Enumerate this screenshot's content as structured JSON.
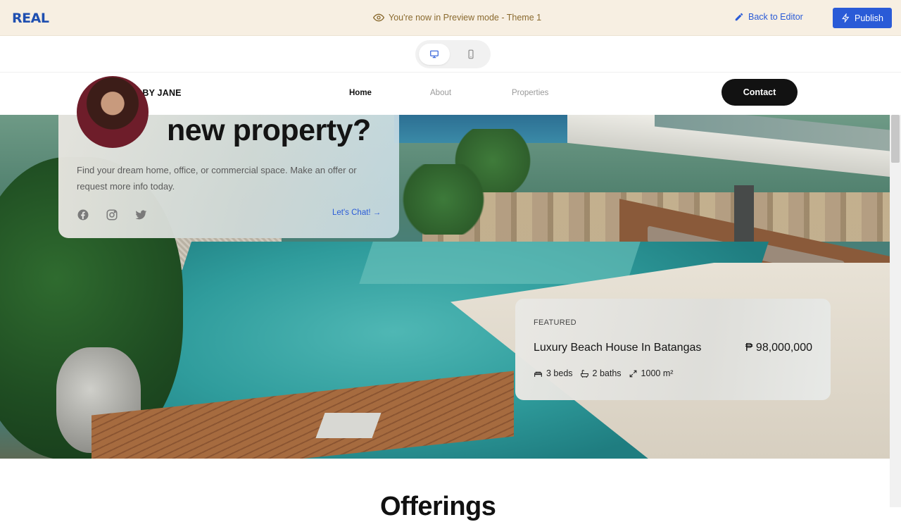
{
  "preview_bar": {
    "logo": "REAL",
    "notice": "You're now in Preview mode - Theme 1",
    "back_to_editor": "Back to Editor",
    "publish": "Publish",
    "background": "#f7efe2",
    "accent": "#2a5bd7"
  },
  "device_toggle": {
    "options": [
      "desktop-icon",
      "mobile-icon"
    ],
    "selected": "desktop"
  },
  "site_nav": {
    "brand": "SPACES BY JANE",
    "links": [
      "Home",
      "About",
      "Properties"
    ],
    "active": "Home",
    "contact": "Contact"
  },
  "hero": {
    "heading": "new property?",
    "description": "Find your dream home, office, or commercial space. Make an offer or request more info today.",
    "social_icons": [
      "facebook-icon",
      "instagram-icon",
      "twitter-icon"
    ],
    "cta": "Let's Chat! →"
  },
  "featured": {
    "tag": "FEATURED",
    "title": "Luxury Beach House In Batangas",
    "price": "₱ 98,000,000",
    "beds": "3 beds",
    "baths": "2 baths",
    "area": "1000 m²"
  },
  "offerings": {
    "title": "Offerings"
  }
}
